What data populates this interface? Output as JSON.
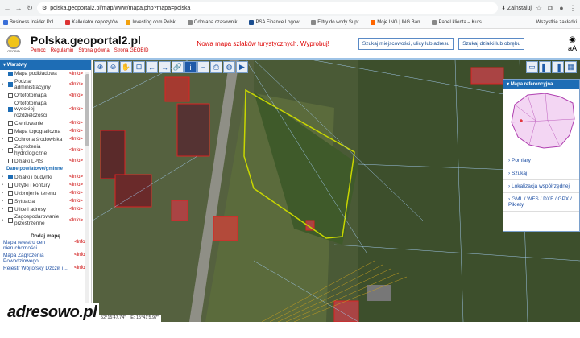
{
  "browser": {
    "url": "polska.geoportal2.pl/map/www/mapa.php?mapa=polska",
    "install_label": "Zainstaluj",
    "bookmarks": [
      {
        "label": "Business Insider Pol...",
        "color": "#3a6fd8"
      },
      {
        "label": "Kalkulator depozytów",
        "color": "#d33"
      },
      {
        "label": "Investing.com Polsk...",
        "color": "#f2a10e"
      },
      {
        "label": "Odmiana czasownik...",
        "color": "#888"
      },
      {
        "label": "PSA Finance Logow...",
        "color": "#1a4d8f"
      },
      {
        "label": "Filtry do wody Supr...",
        "color": "#888"
      },
      {
        "label": "Moje ING | ING Ban...",
        "color": "#f60"
      },
      {
        "label": "Panel klienta – Kurs...",
        "color": "#888"
      }
    ],
    "all_bookmarks_label": "Wszystkie zakładki"
  },
  "site": {
    "title": "Polska.geoportal2.pl",
    "logo_text": "GEOBID",
    "links": [
      "Pomoc",
      "Regulamin",
      "Strona główna",
      "Strona GEOBID"
    ],
    "promo": "Nowa mapa szlaków turystycznych. Wyprobuj!",
    "search_address_btn": "Szukaj miejscowości, ulicy lub adresu",
    "search_parcel_btn": "Szukaj działki lub obrębu"
  },
  "sidebar": {
    "header": "Warstwy",
    "info_label": "<Info>",
    "layers": [
      {
        "name": "Mapa podkładowa",
        "checked": true,
        "expand": false,
        "doc": false
      },
      {
        "name": "Podział administracyjny",
        "checked": true,
        "expand": true,
        "doc": true
      },
      {
        "name": "Ortofotomapa",
        "checked": false,
        "expand": false,
        "doc": false
      },
      {
        "name": "Ortofotomapa wysokiej rozdzielczości",
        "checked": true,
        "expand": false,
        "doc": false
      },
      {
        "name": "Cieniowanie",
        "checked": false,
        "expand": false,
        "doc": false
      },
      {
        "name": "Mapa topograficzna",
        "checked": false,
        "expand": false,
        "doc": false
      },
      {
        "name": "Ochrona środowiska",
        "checked": false,
        "expand": true,
        "doc": true
      },
      {
        "name": "Zagrożenia hydrologiczne",
        "checked": false,
        "expand": true,
        "doc": true
      },
      {
        "name": "Działki LPIS",
        "checked": false,
        "expand": false,
        "doc": true
      }
    ],
    "section_label": "Dane powiatowe/gminne",
    "layers2": [
      {
        "name": "Działki i budynki",
        "checked": true,
        "expand": true,
        "doc": true
      },
      {
        "name": "Użytki i kontury",
        "checked": false,
        "expand": true,
        "doc": false
      },
      {
        "name": "Uzbrojenie terenu",
        "checked": false,
        "expand": true,
        "doc": false
      },
      {
        "name": "Sytuacja",
        "checked": false,
        "expand": true,
        "doc": false
      },
      {
        "name": "Ulice i adresy",
        "checked": false,
        "expand": true,
        "doc": true
      },
      {
        "name": "Zagospodarowanie przestrzenne",
        "checked": false,
        "expand": true,
        "doc": true
      }
    ],
    "add_map_label": "Dodaj mapę",
    "map_links": [
      "Mapa rejestru cen nieruchomości",
      "Mapa Zagrożenia Powodziowego",
      "Rejestr Wójtofsky Dzcziłi i..."
    ]
  },
  "reference_panel": {
    "header": "Mapa referencyjna",
    "items": [
      "Pomiary",
      "Szukaj",
      "Lokalizacja współrzędnej",
      "GML / WFS / DXF / GPX / Pikiety"
    ]
  },
  "coords": {
    "n": "N: 52°15'47.74\"",
    "e": "E: 15°41'5.97\""
  },
  "watermark": "adresowo.pl"
}
